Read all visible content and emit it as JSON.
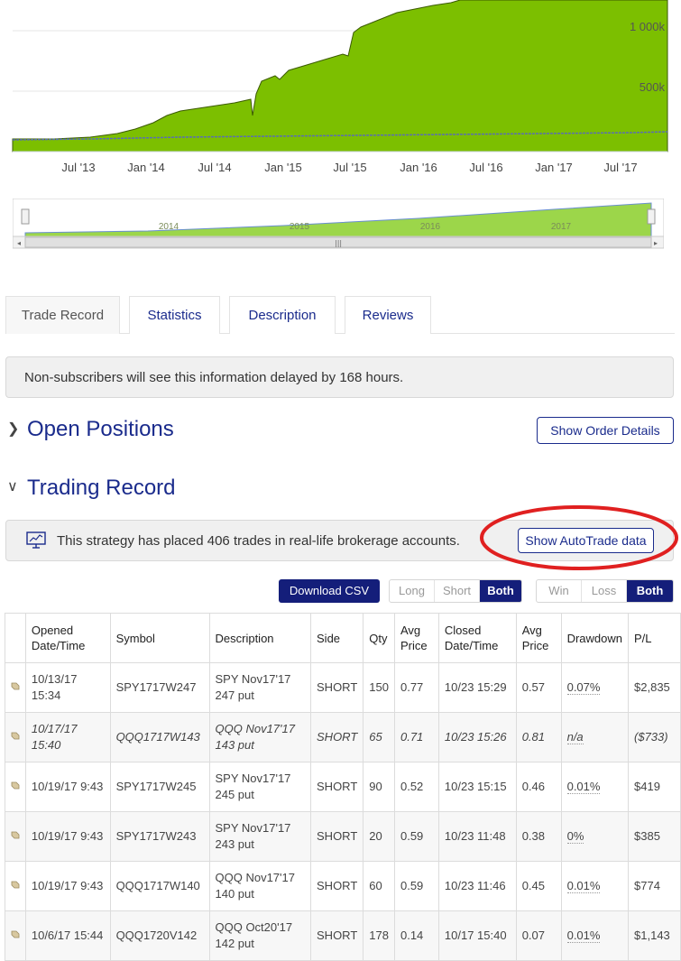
{
  "chart": {
    "y_ticks": [
      "1 000k",
      "500k"
    ],
    "x_ticks": [
      "Jul '13",
      "Jan '14",
      "Jul '14",
      "Jan '15",
      "Jul '15",
      "Jan '16",
      "Jul '16",
      "Jan '17",
      "Jul '17"
    ],
    "navigator_labels": [
      "2014",
      "2015",
      "2016",
      "2017"
    ],
    "colors": {
      "area": "#7cbf00",
      "benchmark": "#5a6fb0",
      "navigator": "#9cd64a"
    }
  },
  "tabs": [
    {
      "label": "Trade Record",
      "active": true
    },
    {
      "label": "Statistics",
      "active": false
    },
    {
      "label": "Description",
      "active": false
    },
    {
      "label": "Reviews",
      "active": false
    }
  ],
  "notice": "Non-subscribers will see this information delayed by 168 hours.",
  "open_positions": {
    "title": "Open Positions",
    "button": "Show Order Details"
  },
  "trading_record": {
    "title": "Trading Record",
    "message": "This strategy has placed 406 trades in real-life brokerage accounts.",
    "button": "Show AutoTrade data"
  },
  "controls": {
    "download": "Download CSV",
    "side_filter": [
      "Long",
      "Short",
      "Both"
    ],
    "outcome_filter": [
      "Win",
      "Loss",
      "Both"
    ]
  },
  "table": {
    "headers": {
      "opened": [
        "Opened",
        "Date/Time"
      ],
      "symbol": "Symbol",
      "description": "Description",
      "side": "Side",
      "qty": "Qty",
      "avg_price_open": [
        "Avg",
        "Price"
      ],
      "closed": [
        "Closed",
        "Date/Time"
      ],
      "avg_price_close": [
        "Avg",
        "Price"
      ],
      "drawdown": "Drawdown",
      "pl": "P/L"
    },
    "rows": [
      {
        "opened": [
          "10/13/17",
          "15:34"
        ],
        "symbol": "SPY1717W247",
        "description": [
          "SPY Nov17'17",
          "247 put"
        ],
        "side": "SHORT",
        "qty": "150",
        "avg_open": "0.77",
        "closed": "10/23 15:29",
        "avg_close": "0.57",
        "drawdown": "0.07%",
        "pl": "$2,835"
      },
      {
        "opened": [
          "10/17/17",
          "15:40"
        ],
        "symbol": "QQQ1717W143",
        "description": [
          "QQQ Nov17'17",
          "143 put"
        ],
        "side": "SHORT",
        "qty": "65",
        "avg_open": "0.71",
        "closed": "10/23 15:26",
        "avg_close": "0.81",
        "drawdown": "n/a",
        "pl": "($733)"
      },
      {
        "opened": [
          "10/19/17 9:43"
        ],
        "symbol": "SPY1717W245",
        "description": [
          "SPY Nov17'17",
          "245 put"
        ],
        "side": "SHORT",
        "qty": "90",
        "avg_open": "0.52",
        "closed": "10/23 15:15",
        "avg_close": "0.46",
        "drawdown": "0.01%",
        "pl": "$419"
      },
      {
        "opened": [
          "10/19/17 9:43"
        ],
        "symbol": "SPY1717W243",
        "description": [
          "SPY Nov17'17",
          "243 put"
        ],
        "side": "SHORT",
        "qty": "20",
        "avg_open": "0.59",
        "closed": "10/23 11:48",
        "avg_close": "0.38",
        "drawdown": "0%",
        "pl": "$385"
      },
      {
        "opened": [
          "10/19/17 9:43"
        ],
        "symbol": "QQQ1717W140",
        "description": [
          "QQQ Nov17'17",
          "140 put"
        ],
        "side": "SHORT",
        "qty": "60",
        "avg_open": "0.59",
        "closed": "10/23 11:46",
        "avg_close": "0.45",
        "drawdown": "0.01%",
        "pl": "$774"
      },
      {
        "opened": [
          "10/6/17 15:44"
        ],
        "symbol": "QQQ1720V142",
        "description": [
          "QQQ Oct20'17",
          "142 put"
        ],
        "side": "SHORT",
        "qty": "178",
        "avg_open": "0.14",
        "closed": "10/17 15:40",
        "avg_close": "0.07",
        "drawdown": "0.01%",
        "pl": "$1,143"
      }
    ]
  }
}
